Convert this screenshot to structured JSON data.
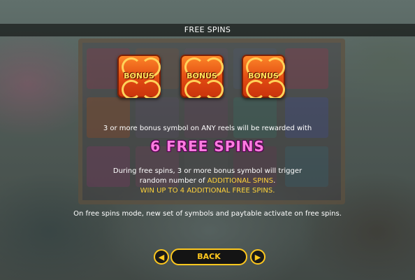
{
  "header": {
    "title": "FREE SPINS"
  },
  "bonus_symbols": [
    {
      "label": "BONUS"
    },
    {
      "label": "BONUS"
    },
    {
      "label": "BONUS"
    }
  ],
  "content": {
    "line1": "3  or more bonus symbol on ANY reels will be rewarded with",
    "highlight": "6 FREE SPINS",
    "line2": "During free spins, 3 or more bonus symbol will trigger",
    "line3_prefix": "random number of ",
    "line3_highlight": "ADDITIONAL SPINS",
    "line3_suffix": ".",
    "line4": "WIN UP TO 4 ADDITIONAL FREE SPINS.",
    "line5": "On free spins mode, new set of symbols and paytable activate on free spins."
  },
  "nav": {
    "prev_icon": "left-arrow-icon",
    "back_label": "BACK",
    "next_icon": "right-arrow-icon"
  },
  "colors": {
    "accent": "#ffc81e",
    "highlight_pink": "#ff7be0",
    "highlight_yellow": "#ffd23a"
  }
}
